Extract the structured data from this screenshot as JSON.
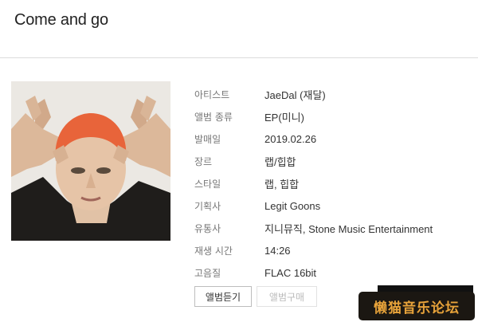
{
  "album": {
    "title": "Come and go"
  },
  "details": [
    {
      "label": "아티스트",
      "value": "JaeDal (재달)"
    },
    {
      "label": "앨범 종류",
      "value": "EP(미니)"
    },
    {
      "label": "발매일",
      "value": "2019.02.26"
    },
    {
      "label": "장르",
      "value": "랩/힙합"
    },
    {
      "label": "스타일",
      "value": "랩, 힙합"
    },
    {
      "label": "기획사",
      "value": "Legit Goons"
    },
    {
      "label": "유통사",
      "value": "지니뮤직, Stone Music Entertainment"
    },
    {
      "label": "재생 시간",
      "value": "14:26"
    },
    {
      "label": "고음질",
      "value": "FLAC 16bit"
    }
  ],
  "buttons": {
    "listen": "앨범듣기",
    "buy": "앨범구매"
  },
  "watermark": {
    "text": "懒猫音乐论坛"
  },
  "colors": {
    "hair": "#e8643a",
    "watermark": "#e8a33a"
  }
}
